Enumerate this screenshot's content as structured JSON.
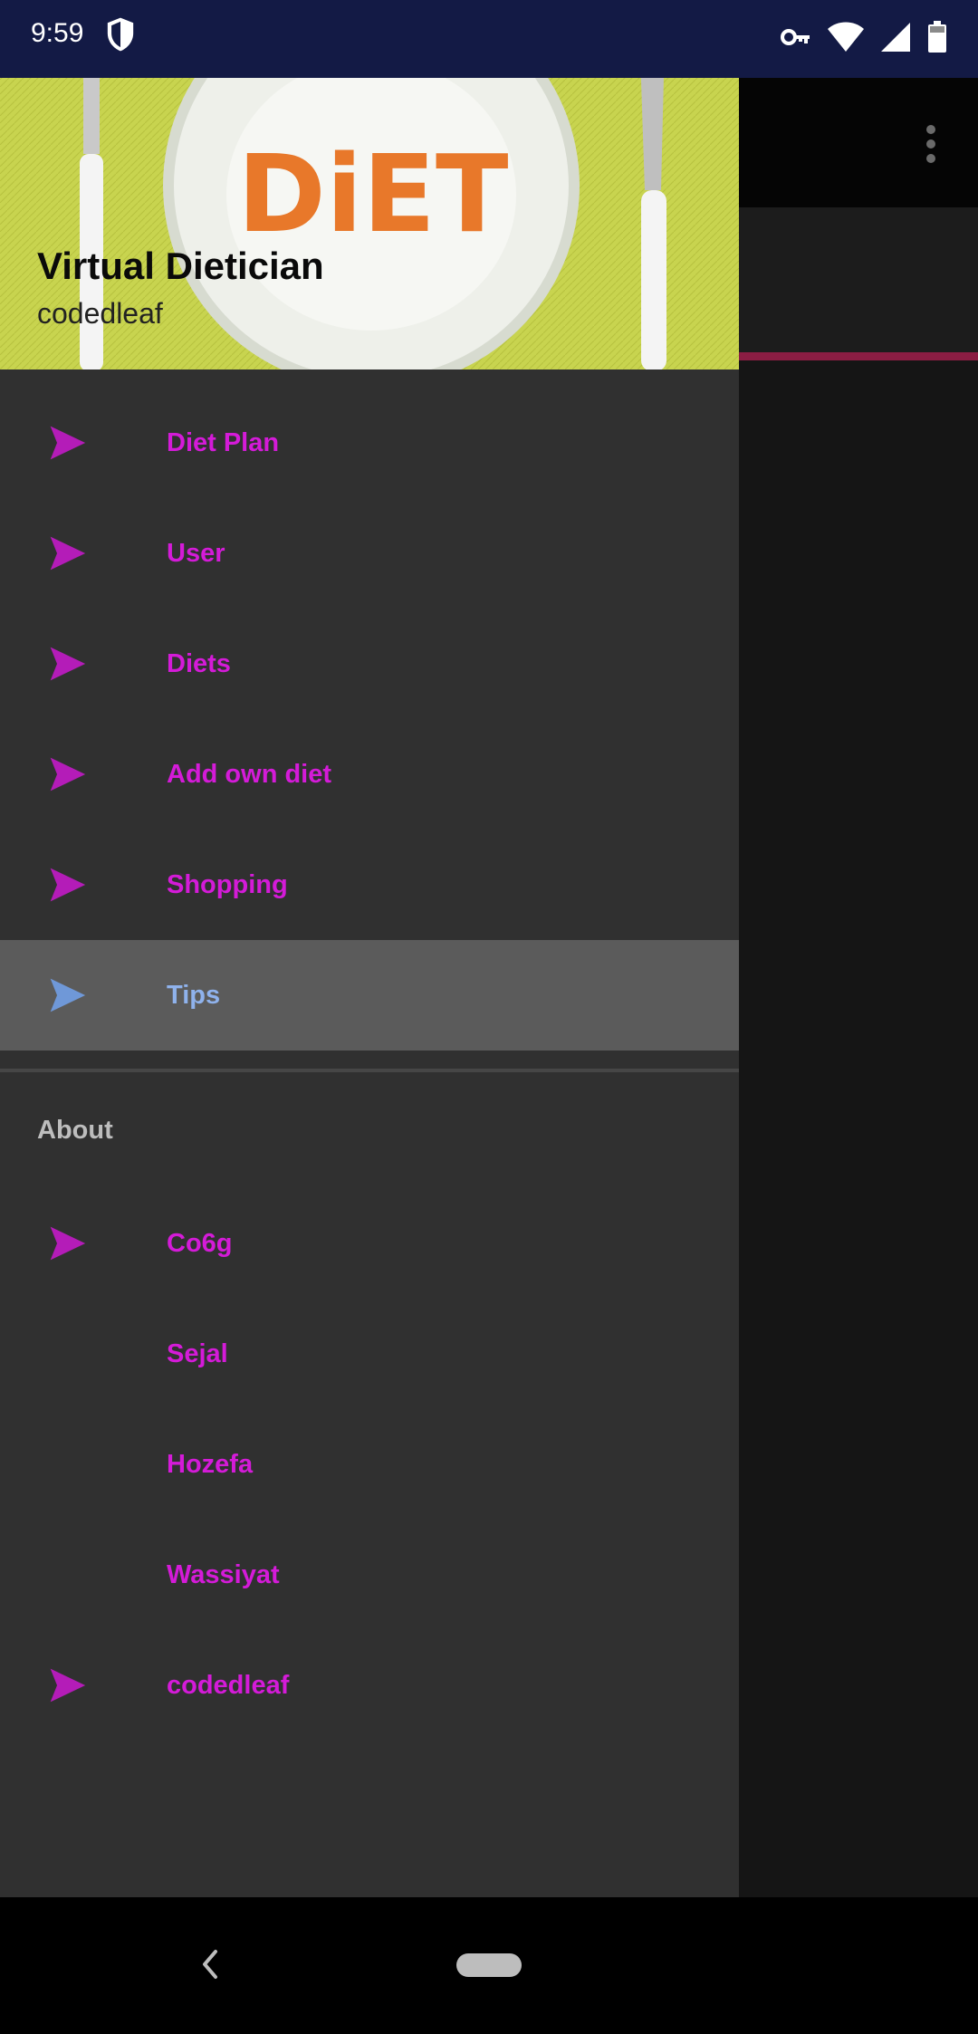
{
  "status_bar": {
    "time": "9:59",
    "icons": [
      "shield-icon",
      "vpn-key-icon",
      "wifi-icon",
      "cell-signal-icon",
      "battery-icon"
    ]
  },
  "drawer": {
    "header": {
      "title": "Virtual Dietician",
      "subtitle": "codedleaf",
      "image_text": "DiET"
    },
    "items": [
      {
        "label": "Diet Plan",
        "icon": "send-icon"
      },
      {
        "label": "User",
        "icon": "send-icon"
      },
      {
        "label": "Diets",
        "icon": "send-icon"
      },
      {
        "label": "Add own diet",
        "icon": "send-icon"
      },
      {
        "label": "Shopping",
        "icon": "send-icon"
      },
      {
        "label": "Tips",
        "icon": "send-icon",
        "selected": true
      }
    ],
    "about_section": {
      "heading": "About",
      "items": [
        {
          "label": "Co6g",
          "icon": "send-icon"
        },
        {
          "label": "Sejal",
          "icon": ""
        },
        {
          "label": "Hozefa",
          "icon": ""
        },
        {
          "label": "Wassiyat",
          "icon": ""
        },
        {
          "label": "codedleaf",
          "icon": "send-icon"
        }
      ]
    }
  },
  "colors": {
    "accent": "#d41bd8",
    "selected_text": "#8fb2ec",
    "drawer_bg": "#303030",
    "selected_bg": "#5b5b5b",
    "app_accent": "#8b1d43",
    "status_bar": "#131a45"
  },
  "nav_bar": {
    "icons": [
      "back-icon",
      "home-pill-icon"
    ]
  }
}
